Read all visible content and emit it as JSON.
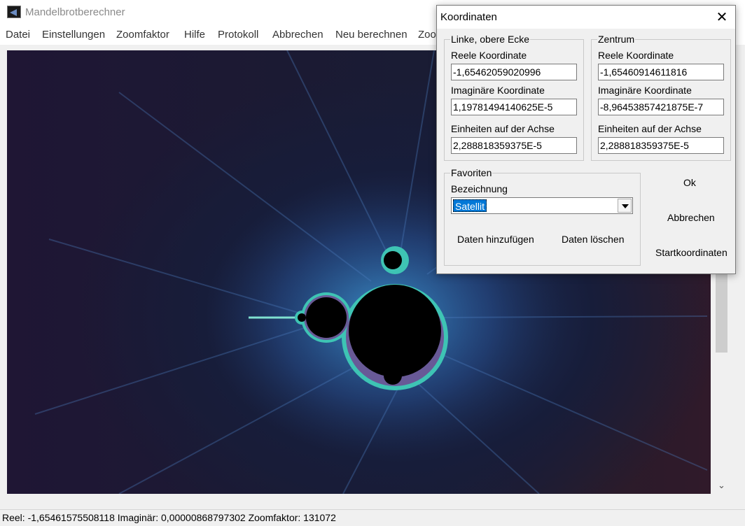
{
  "app": {
    "title": "Mandelbrotberechner"
  },
  "menu": {
    "items": [
      "Datei",
      "Einstellungen",
      "Zoomfaktor",
      "Hilfe",
      "Protokoll",
      "Abbrechen",
      "Neu berechnen",
      "Zoo"
    ]
  },
  "status": {
    "text": "Reel: -1,65461575508118 Imaginär: 0,00000868797302 Zoomfaktor: 131072"
  },
  "dialog": {
    "title": "Koordinaten",
    "close_glyph": "✕",
    "top_left": {
      "legend": "Linke, obere Ecke",
      "real_label": "Reele Koordinate",
      "real_value": "-1,65462059020996",
      "imag_label": "Imaginäre Koordinate",
      "imag_value": "1,19781494140625E-5",
      "units_label": "Einheiten auf der Achse",
      "units_value": "2,288818359375E-5"
    },
    "center": {
      "legend": "Zentrum",
      "real_label": "Reele Koordinate",
      "real_value": "-1,65460914611816",
      "imag_label": "Imaginäre Koordinate",
      "imag_value": "-8,96453857421875E-7",
      "units_label": "Einheiten auf der Achse",
      "units_value": "2,288818359375E-5"
    },
    "favorites": {
      "legend": "Favoriten",
      "name_label": "Bezeichnung",
      "selected": "Satellit",
      "add_button": "Daten hinzufügen",
      "delete_button": "Daten löschen"
    },
    "buttons": {
      "ok": "Ok",
      "cancel": "Abbrechen",
      "start": "Startkoordinaten"
    }
  }
}
